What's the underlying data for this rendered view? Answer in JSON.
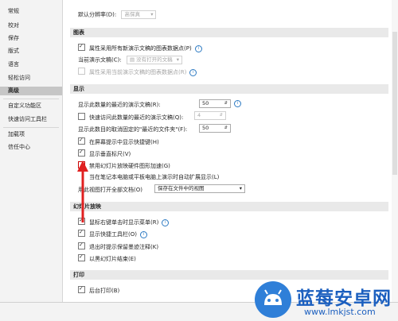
{
  "sidebar": {
    "items": [
      {
        "label": "常规"
      },
      {
        "label": "校对"
      },
      {
        "label": "保存"
      },
      {
        "label": "版式"
      },
      {
        "label": "语言"
      },
      {
        "label": "轻松访问"
      },
      {
        "label": "高级"
      },
      {
        "label": "自定义功能区"
      },
      {
        "label": "快速访问工具栏"
      },
      {
        "label": "加载项"
      },
      {
        "label": "信任中心"
      }
    ],
    "active_index": 6
  },
  "top": {
    "resolution_label": "默认分辨率(D):",
    "resolution_value": "高保真"
  },
  "charts": {
    "header": "图表",
    "chk1": "属性采用所有新演示文稿的图表数据点(P)",
    "current_label": "当前演示文稿(C):",
    "current_value": "没有打开的文稿",
    "chk2": "属性采用当前演示文稿的图表数据点(R)"
  },
  "display": {
    "header": "显示",
    "recent_label": "显示此数量的最近的演示文稿(R):",
    "recent_value": "50",
    "quick_access_label": "快速访问此数量的最近的演示文稿(Q):",
    "quick_access_value": "4",
    "unpinned_label": "显示此数目的取消固定的\"最近的文件夹\"(F):",
    "unpinned_value": "50",
    "shortcut_tips": "在屏幕提示中显示快捷键(H)",
    "vertical_ruler": "显示垂直标尺(V)",
    "disable_hw": "禁用幻灯片放映硬件图形加速(G)",
    "auto_extend": "当在笔记本电脑或平板电脑上演示时自动扩展显示(L)",
    "open_view_label": "用此视图打开全部文档(O)",
    "open_view_value": "保存在文件中的视图"
  },
  "slideshow": {
    "header": "幻灯片放映",
    "menu_right_click": "鼠标右键单击时显示菜单(R)",
    "popup_toolbar": "显示快捷工具栏(O)",
    "keep_ink": "退出时提示保留墨迹注释(K)",
    "end_black": "以黑幻灯片结束(E)"
  },
  "print": {
    "header": "打印",
    "background_print": "后台打印(B)"
  },
  "watermark": {
    "title": "蓝莓安卓网",
    "url": "www.lmkjst.com"
  },
  "colors": {
    "accent": "#2f7fd8",
    "arrow": "#e02020"
  },
  "icons": {
    "info": "info-icon",
    "chevron": "chevron-down-icon",
    "spinner": "spinner-arrows-icon"
  }
}
